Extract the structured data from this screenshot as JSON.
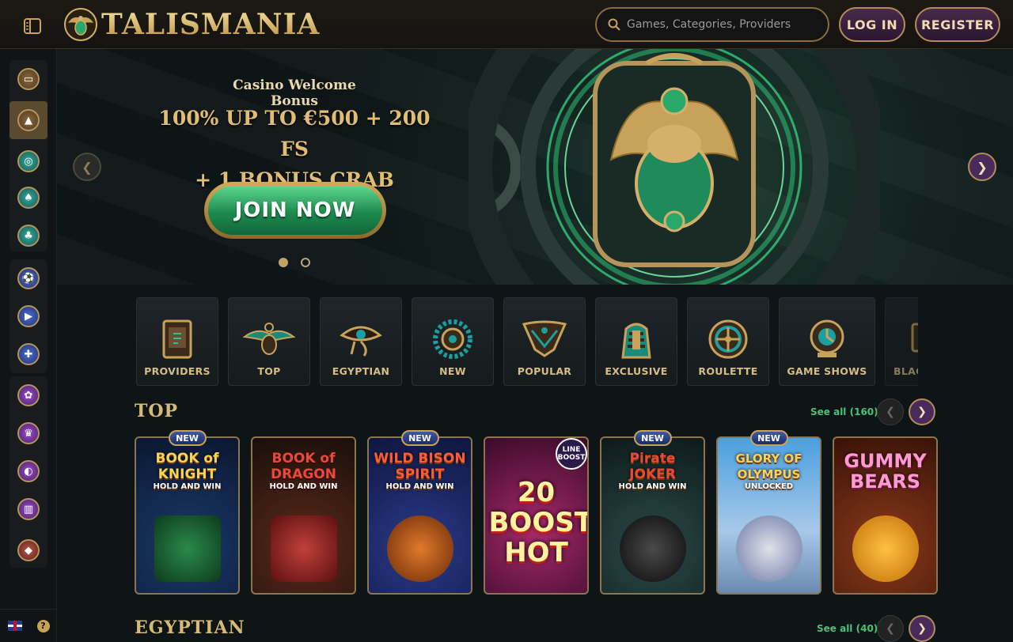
{
  "header": {
    "logo_text": "TALISMANIA",
    "search_placeholder": "Games, Categories, Providers",
    "login_label": "LOG IN",
    "register_label": "REGISTER"
  },
  "hero": {
    "subtitle": "Casino Welcome Bonus",
    "title_line1": "100% UP TO €500 + 200 FS",
    "title_line2": "+ 1 BONUS CRAB",
    "cta_label": "JOIN NOW",
    "slides_total": 2,
    "active_slide": 1
  },
  "categories": [
    {
      "label": "PROVIDERS",
      "icon": "scroll-icon"
    },
    {
      "label": "TOP",
      "icon": "scarab-icon"
    },
    {
      "label": "EGYPTIAN",
      "icon": "eye-of-horus-icon"
    },
    {
      "label": "NEW",
      "icon": "sun-disc-icon"
    },
    {
      "label": "POPULAR",
      "icon": "pharaoh-crown-icon"
    },
    {
      "label": "EXCLUSIVE",
      "icon": "pharaoh-head-icon"
    },
    {
      "label": "ROULETTE",
      "icon": "roulette-wheel-icon"
    },
    {
      "label": "GAME SHOWS",
      "icon": "wheel-of-fortune-icon"
    },
    {
      "label": "BLACKJACK",
      "icon": "cards-icon"
    }
  ],
  "sections": {
    "top": {
      "title": "TOP",
      "see_all": "See all",
      "count": "(160)"
    },
    "egyptian": {
      "title": "EGYPTIAN",
      "see_all": "See all",
      "count": "(40)"
    }
  },
  "games": [
    {
      "title": "BOOK of KNIGHT",
      "sub": "HOLD AND WIN",
      "badge": "NEW"
    },
    {
      "title": "BOOK of DRAGON",
      "sub": "HOLD AND WIN",
      "badge": ""
    },
    {
      "title": "WILD BISON SPIRIT",
      "sub": "HOLD AND WIN",
      "badge": "NEW"
    },
    {
      "title": "20 BOOST HOT",
      "sub": "",
      "badge": "LINE BOOST"
    },
    {
      "title": "Pirate JOKER",
      "sub": "HOLD AND WIN",
      "badge": "NEW"
    },
    {
      "title": "GLORY OF OLYMPUS",
      "sub": "UNLOCKED",
      "badge": "NEW"
    },
    {
      "title": "GUMMY BEARS",
      "sub": "",
      "badge": ""
    }
  ],
  "sidebar": {
    "language": "EN",
    "help": "?"
  },
  "colors": {
    "accent_gold": "#c8a25a",
    "accent_green": "#47c27a",
    "button_purple": "#4a2a5a"
  }
}
